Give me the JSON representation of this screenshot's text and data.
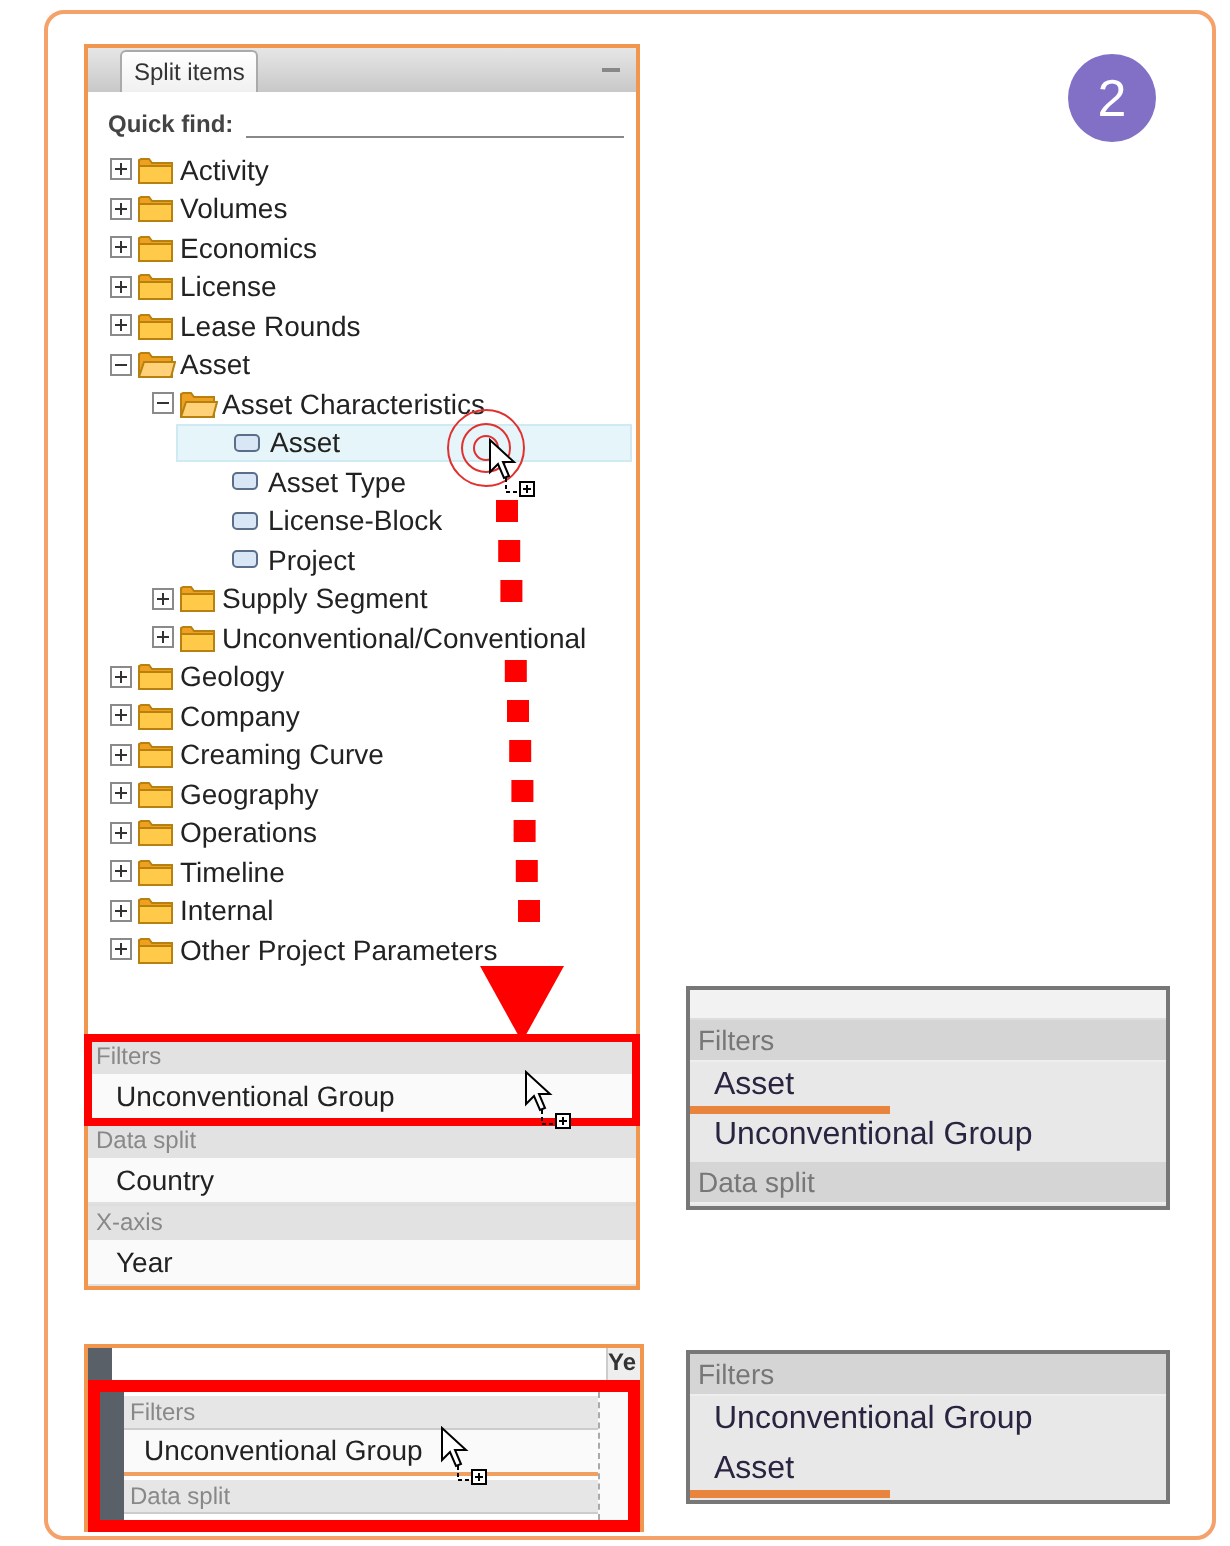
{
  "badge": "2",
  "main_panel": {
    "tab": "Split items",
    "quick_find": {
      "label": "Quick find:"
    },
    "tree": [
      {
        "label": "Activity",
        "kind": "folder",
        "expanded": false,
        "selected": false
      },
      {
        "label": "Volumes",
        "kind": "folder",
        "expanded": false,
        "selected": false
      },
      {
        "label": "Economics",
        "kind": "folder",
        "expanded": false,
        "selected": false
      },
      {
        "label": "License",
        "kind": "folder",
        "expanded": false,
        "selected": false
      },
      {
        "label": "Lease Rounds",
        "kind": "folder",
        "expanded": false,
        "selected": false
      },
      {
        "label": "Asset",
        "kind": "folder",
        "expanded": true,
        "selected": false,
        "children": [
          {
            "label": "Asset Characteristics",
            "kind": "folder",
            "expanded": true,
            "selected": false,
            "children": [
              {
                "label": "Asset",
                "kind": "leaf",
                "selected": true
              },
              {
                "label": "Asset Type",
                "kind": "leaf",
                "selected": false
              },
              {
                "label": "License-Block",
                "kind": "leaf",
                "selected": false
              },
              {
                "label": "Project",
                "kind": "leaf",
                "selected": false
              }
            ]
          },
          {
            "label": "Supply Segment",
            "kind": "folder",
            "expanded": false,
            "selected": false
          },
          {
            "label": "Unconventional/Conventional",
            "kind": "folder",
            "expanded": false,
            "selected": false
          }
        ]
      },
      {
        "label": "Geology",
        "kind": "folder",
        "expanded": false,
        "selected": false
      },
      {
        "label": "Company",
        "kind": "folder",
        "expanded": false,
        "selected": false
      },
      {
        "label": "Creaming Curve",
        "kind": "folder",
        "expanded": false,
        "selected": false
      },
      {
        "label": "Geography",
        "kind": "folder",
        "expanded": false,
        "selected": false
      },
      {
        "label": "Operations",
        "kind": "folder",
        "expanded": false,
        "selected": false
      },
      {
        "label": "Timeline",
        "kind": "folder",
        "expanded": false,
        "selected": false
      },
      {
        "label": "Internal",
        "kind": "folder",
        "expanded": false,
        "selected": false
      },
      {
        "label": "Other Project Parameters",
        "kind": "folder",
        "expanded": false,
        "selected": false
      }
    ],
    "zones": [
      {
        "title": "Filters",
        "highlighted": true,
        "items": [
          {
            "label": "Unconventional Group"
          }
        ]
      },
      {
        "title": "Data split",
        "highlighted": false,
        "items": [
          {
            "label": "Country"
          }
        ]
      },
      {
        "title": "X-axis",
        "highlighted": false,
        "items": [
          {
            "label": "Year"
          }
        ]
      }
    ]
  },
  "drop_result_top": {
    "zones": [
      {
        "title": "Filters",
        "items": [
          {
            "label": "Asset",
            "drop_marker": true
          },
          {
            "label": "Unconventional Group",
            "drop_marker": false
          }
        ]
      },
      {
        "title": "Data split"
      }
    ]
  },
  "drag_preview": {
    "column_header": "Ye",
    "highlighted": true,
    "zones": [
      {
        "title": "Filters",
        "items": [
          {
            "label": "Unconventional Group",
            "drop_marker": true
          }
        ]
      },
      {
        "title": "Data split"
      }
    ]
  },
  "drop_result_bottom": {
    "zones": [
      {
        "title": "Filters",
        "items": [
          {
            "label": "Unconventional Group",
            "drop_marker": false
          },
          {
            "label": "Asset",
            "drop_marker": true
          }
        ]
      }
    ]
  }
}
